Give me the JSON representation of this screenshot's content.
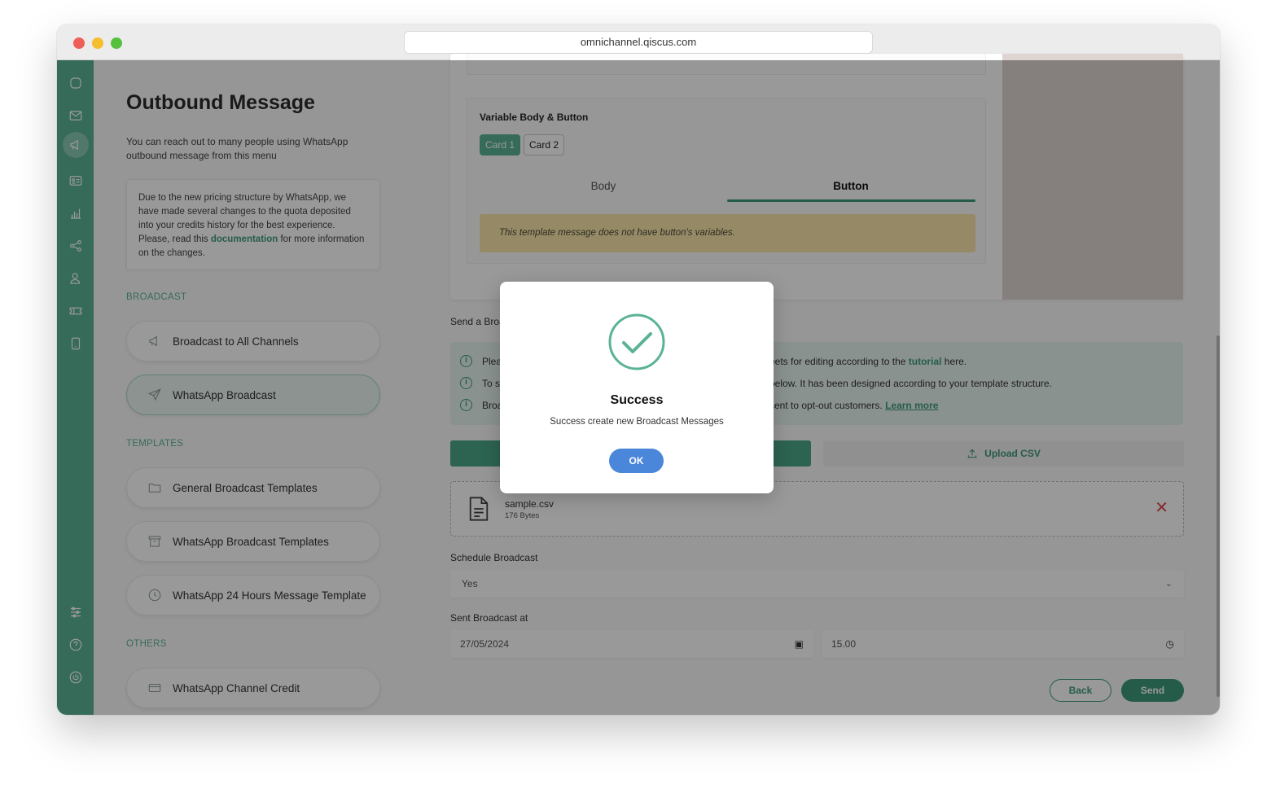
{
  "browser": {
    "url": "omnichannel.qiscus.com"
  },
  "rail": {
    "icons": [
      "chat-icon",
      "mail-icon",
      "megaphone-icon",
      "contact-card-icon",
      "analytics-icon",
      "integration-icon",
      "agent-icon",
      "ticket-icon",
      "mobile-icon",
      "settings-sliders-icon",
      "help-icon",
      "power-icon"
    ]
  },
  "menu": {
    "title": "Outbound Message",
    "intro": "You can reach out to many people using WhatsApp outbound message from this menu",
    "notice_before": "Due to the new pricing structure by WhatsApp, we have made several changes to the quota deposited into your credits history for the best experience. Please, read this ",
    "notice_link": "documentation",
    "notice_after": " for more information on the changes.",
    "sections": {
      "broadcast": "BROADCAST",
      "templates": "TEMPLATES",
      "others": "OTHERS"
    },
    "items": {
      "broadcast_all": "Broadcast to All Channels",
      "whatsapp_broadcast": "WhatsApp Broadcast",
      "general_templates": "General Broadcast Templates",
      "wa_templates": "WhatsApp Broadcast Templates",
      "wa_24h": "WhatsApp 24 Hours Message Template",
      "wa_credit": "WhatsApp Channel Credit"
    }
  },
  "template": {
    "variable_title": "Variable Body & Button",
    "cards": [
      "Card 1",
      "Card 2"
    ],
    "tabs": {
      "body": "Body",
      "button": "Button"
    },
    "warning": "This template message does not have button's variables."
  },
  "send": {
    "label_partial": "Send a Broa",
    "info": {
      "row1_left": "Plea",
      "row1_right": "eets for editing according to the ",
      "row1_link": "tutorial",
      "row1_end": " here.",
      "row2_left": "To s",
      "row2_right": "below. It has been designed according to your template structure.",
      "row3_left": "Broa",
      "row3_right": "sent to opt-out customers. ",
      "row3_link": "Learn more"
    },
    "upload_label": "Upload CSV",
    "file": {
      "name": "sample.csv",
      "size": "176 Bytes"
    },
    "schedule_label": "Schedule Broadcast",
    "schedule_value": "Yes",
    "sent_at_label": "Sent Broadcast at",
    "date_value": "27/05/2024",
    "time_value": "15.00",
    "back_label": "Back",
    "send_label": "Send"
  },
  "modal": {
    "title": "Success",
    "message": "Success create new Broadcast Messages",
    "ok_label": "OK"
  },
  "colors": {
    "brand": "#5ab395",
    "brand_dark": "#3f9a7b",
    "ok_button": "#4a86d9",
    "warning_bg": "#f9e7a8",
    "error": "#d94a4a"
  }
}
